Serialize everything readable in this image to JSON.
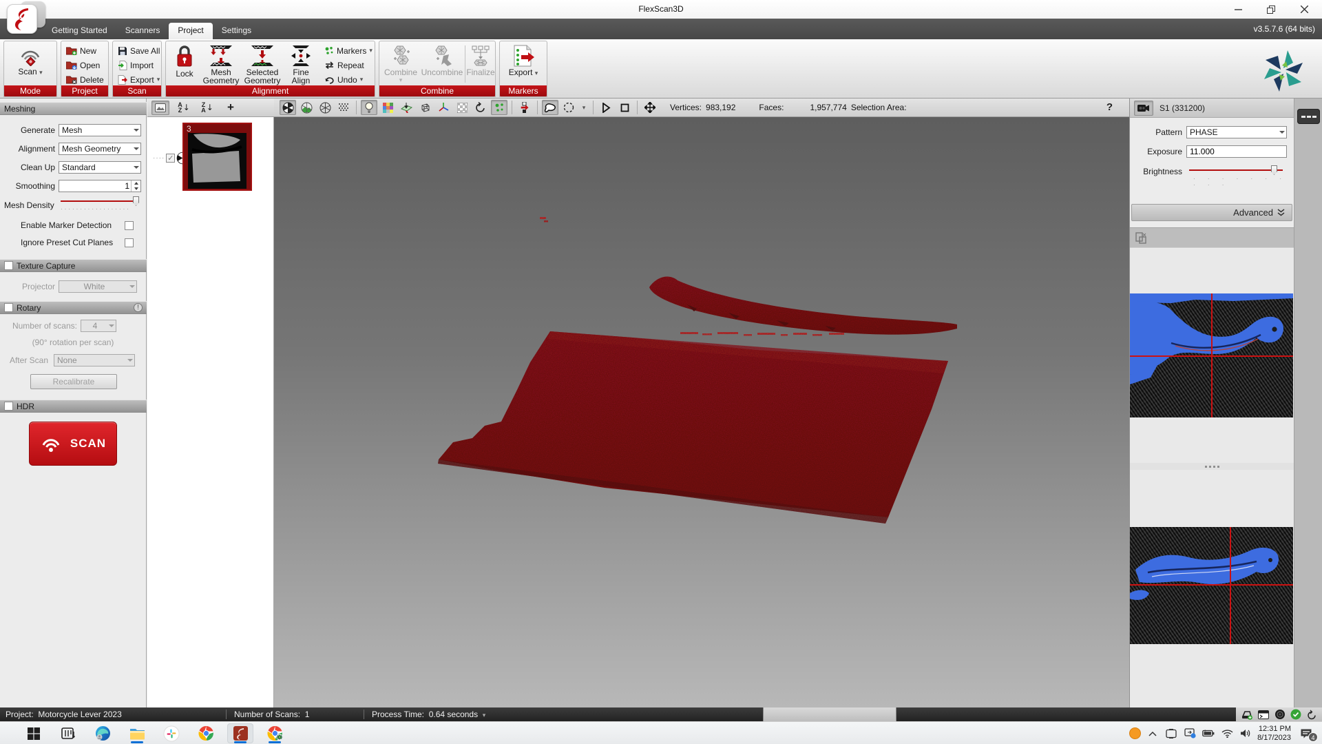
{
  "titlebar": {
    "title": "FlexScan3D"
  },
  "tabstrip": {
    "tabs": {
      "0": "Getting Started",
      "1": "Scanners",
      "2": "Project",
      "3": "Settings"
    },
    "version": "v3.5.7.6  (64 bits)"
  },
  "ribbon": {
    "scan": "Scan",
    "group_mode": "Mode",
    "new": "New",
    "open": "Open",
    "delete": "Delete",
    "group_project": "Project",
    "save_all": "Save All",
    "import": "Import",
    "export": "Export",
    "group_scan": "Scan",
    "lock": "Lock",
    "mesh_geometry": "Mesh Geometry",
    "selected_geometry": "Selected Geometry",
    "fine_align": "Fine Align",
    "markers": "Markers",
    "repeat": "Repeat",
    "undo": "Undo",
    "group_alignment": "Alignment",
    "combine": "Combine",
    "uncombine": "Uncombine",
    "finalize": "Finalize",
    "group_combine": "Combine",
    "export_markers": "Export",
    "group_markers": "Markers"
  },
  "meshing": {
    "header": "Meshing",
    "generate_label": "Generate",
    "generate_value": "Mesh",
    "alignment_label": "Alignment",
    "alignment_value": "Mesh Geometry",
    "cleanup_label": "Clean Up",
    "cleanup_value": "Standard",
    "smoothing_label": "Smoothing",
    "smoothing_value": "1",
    "density_label": "Mesh Density",
    "marker_detection_label": "Enable Marker Detection",
    "cut_planes_label": "Ignore Preset Cut Planes"
  },
  "texture": {
    "header": "Texture Capture",
    "projector_label": "Projector",
    "projector_value": "White"
  },
  "rotary": {
    "header": "Rotary",
    "scans_label": "Number of scans:",
    "scans_value": "4",
    "note": "(90° rotation per scan)",
    "after_label": "After Scan",
    "after_value": "None",
    "recalibrate": "Recalibrate"
  },
  "hdr": {
    "header": "HDR"
  },
  "scan_action": {
    "label": "SCAN"
  },
  "scan_list": {
    "item_badge": "3",
    "letter_a": "A",
    "letter_z": "Z",
    "sort_arrow": "↓"
  },
  "viewport_toolbar": {
    "vertices_label": "Vertices:",
    "vertices": "983,192",
    "faces_label": "Faces:",
    "faces": "1,957,774",
    "selection_label": "Selection Area:",
    "help": "?"
  },
  "camera_panel": {
    "title": "S1 (331200)",
    "pattern_label": "Pattern",
    "pattern_value": "PHASE",
    "exposure_label": "Exposure",
    "exposure_value": "11.000",
    "brightness_label": "Brightness",
    "advanced": "Advanced"
  },
  "statusbar": {
    "project_label": "Project:",
    "project_value": "Motorcycle Lever 2023",
    "scans_label": "Number of Scans:",
    "scans_value": "1",
    "time_label": "Process Time:",
    "time_value": "0.64 seconds"
  },
  "taskbar": {
    "time": "12:31 PM",
    "date": "8/17/2023",
    "notification_count": "4"
  },
  "icons": {
    "caret": "▾",
    "plus": "+",
    "check": "✓",
    "exclaim": "!",
    "dots": "····",
    "tick_row_long": "··················",
    "tick_row_short": "· · · · · · · · · ·"
  },
  "colors": {
    "accent_red": "#b50d11",
    "scan_red": "#cc1016",
    "preview_blue": "#3d6ce0",
    "run_indicator_blue": "#0b6fd6",
    "ok_green": "#35a435"
  }
}
